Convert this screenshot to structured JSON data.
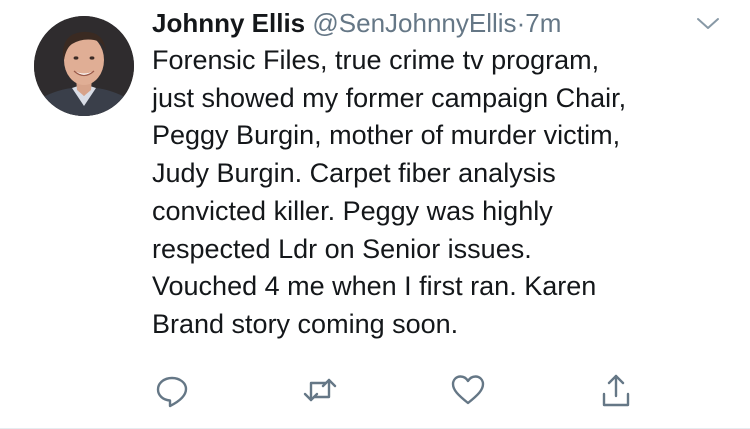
{
  "tweet": {
    "author_name": "Johnny Ellis",
    "handle": "@SenJohnnyEllis",
    "separator": "·",
    "time": "7m",
    "lines": [
      "Forensic Files, true crime tv program,",
      "just showed my former campaign Chair,",
      "Peggy Burgin, mother of murder victim,",
      "Judy Burgin. Carpet fiber analysis",
      "convicted killer. Peggy was highly",
      "respected Ldr on Senior issues.",
      "Vouched 4 me when I first ran. Karen",
      "Brand story coming soon."
    ]
  },
  "icons": {
    "menu": "chevron-down-icon",
    "reply": "reply-icon",
    "retweet": "retweet-icon",
    "like": "heart-icon",
    "share": "share-icon"
  },
  "colors": {
    "text": "#14171a",
    "secondary": "#657786",
    "icon": "#657786",
    "background": "#ffffff"
  }
}
